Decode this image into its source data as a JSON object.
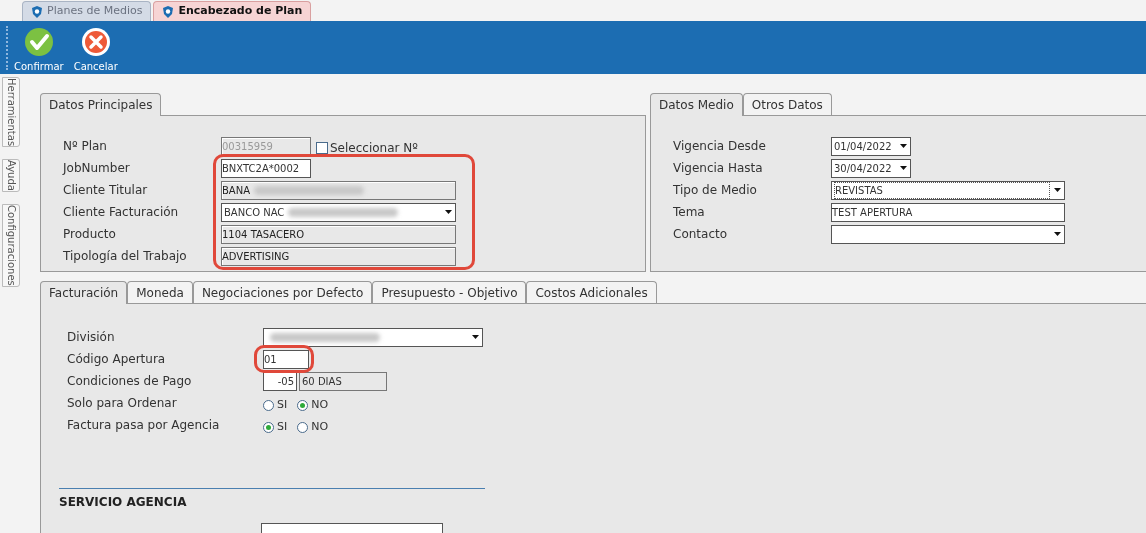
{
  "window_tabs": [
    {
      "label": "Planes de Medios",
      "selected": false
    },
    {
      "label": "Encabezado de Plan",
      "selected": true
    }
  ],
  "toolbar": [
    {
      "kind": "confirm",
      "label": "Confirmar"
    },
    {
      "kind": "cancel",
      "label": "Cancelar"
    }
  ],
  "side_tabs": [
    "Herramientas",
    "Ayuda",
    "Configuraciones"
  ],
  "main_panel": {
    "tabs": [
      {
        "label": "Datos Principales",
        "selected": true
      }
    ],
    "fields": [
      {
        "label": "Nº Plan",
        "kind": "number",
        "value": "00315959",
        "highlighted": false,
        "checkbox": {
          "label": "Seleccionar Nº",
          "checked": false
        }
      },
      {
        "label": "JobNumber",
        "kind": "text",
        "value": "BNXTC2A*0002",
        "highlighted": true
      },
      {
        "label": "Cliente Titular",
        "kind": "readonly",
        "value": "BANA",
        "redacted": true,
        "highlighted": true
      },
      {
        "label": "Cliente Facturación",
        "kind": "combo",
        "value": "BANCO NAC",
        "redacted": true,
        "highlighted": true
      },
      {
        "label": "Producto",
        "kind": "readonly",
        "value": "1104 TASACERO",
        "highlighted": true
      },
      {
        "label": "Tipología del Trabajo",
        "kind": "readonly",
        "value": "ADVERTISING",
        "highlighted": true
      }
    ]
  },
  "media_panel": {
    "tabs": [
      {
        "label": "Datos Medio",
        "selected": true
      },
      {
        "label": "Otros Datos",
        "selected": false
      }
    ],
    "fields": [
      {
        "label": "Vigencia Desde",
        "kind": "date",
        "value": "01/04/2022"
      },
      {
        "label": "Vigencia Hasta",
        "kind": "date",
        "value": "30/04/2022"
      },
      {
        "label": "Tipo de Medio",
        "kind": "combo",
        "value": "REVISTAS",
        "focused": true
      },
      {
        "label": "Tema",
        "kind": "entry",
        "value": "TEST APERTURA"
      },
      {
        "label": "Contacto",
        "kind": "combo"
      }
    ]
  },
  "billing_panel": {
    "tabs": [
      {
        "label": "Facturación",
        "selected": true
      },
      {
        "label": "Moneda",
        "selected": false
      },
      {
        "label": "Negociaciones por Defecto",
        "selected": false
      },
      {
        "label": "Presupuesto - Objetivo",
        "selected": false
      },
      {
        "label": "Costos Adicionales",
        "selected": false
      }
    ],
    "fields": [
      {
        "label": "División",
        "kind": "combo",
        "redacted": true,
        "highlighted": false
      },
      {
        "label": "Código Apertura",
        "kind": "code",
        "value": "01",
        "highlighted": true
      },
      {
        "label": "Condiciones de Pago",
        "kind": "pair",
        "value": "-05",
        "detail": "60 DIAS",
        "highlighted": false
      },
      {
        "label": "Solo para Ordenar",
        "kind": "radio",
        "options": [
          {
            "label": "SI",
            "selected": false
          },
          {
            "label": "NO",
            "selected": true
          }
        ],
        "highlighted": false
      },
      {
        "label": "Factura pasa por Agencia",
        "kind": "radio",
        "options": [
          {
            "label": "SI",
            "selected": true
          },
          {
            "label": "NO",
            "selected": false
          }
        ],
        "highlighted": false
      }
    ],
    "section_title": "SERVICIO AGENCIA"
  }
}
